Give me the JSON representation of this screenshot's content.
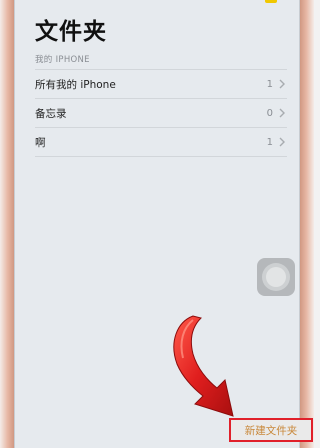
{
  "page": {
    "title": "文件夹"
  },
  "folders_section": {
    "header": "我的 IPHONE",
    "items": [
      {
        "label": "所有我的 iPhone",
        "count": "1"
      },
      {
        "label": "备忘录",
        "count": "0"
      },
      {
        "label": "啊",
        "count": "1"
      }
    ]
  },
  "toolbar": {
    "new_folder_label": "新建文件夹"
  },
  "colors": {
    "frame_accent": "#e7b7a4",
    "highlight_border": "#e0202a",
    "arrow_red": "#d41e1e",
    "button_text": "#c9883a"
  },
  "icons": {
    "chevron": "chevron-right-icon",
    "assistive_touch": "assistive-touch-icon",
    "annotation_arrow": "red-arrow-icon"
  }
}
